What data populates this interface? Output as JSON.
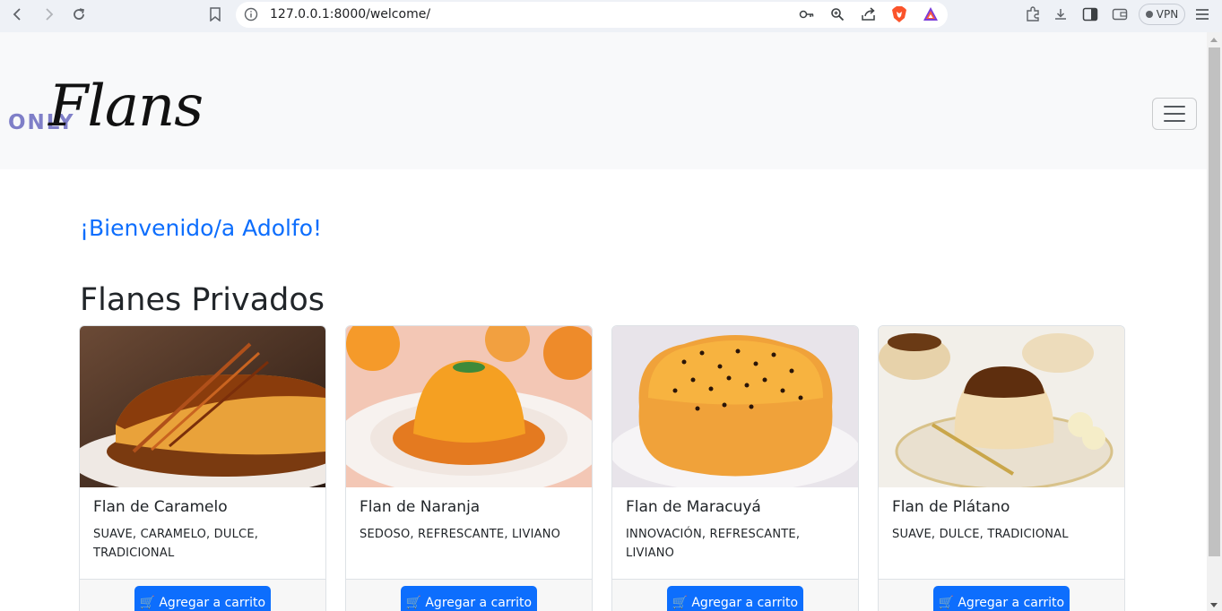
{
  "browser": {
    "url": "127.0.0.1:8000/welcome/",
    "vpn_label": "VPN"
  },
  "navbar": {
    "brand_only": "ONLY",
    "brand_flans": "Flans"
  },
  "welcome_text": "¡Bienvenido/a Adolfo!",
  "section_title": "Flanes Privados",
  "cards": [
    {
      "title": "Flan de Caramelo",
      "tags": "SUAVE, CARAMELO, DULCE, TRADICIONAL",
      "button": "Agregar a carrito"
    },
    {
      "title": "Flan de Naranja",
      "tags": "SEDOSO, REFRESCANTE, LIVIANO",
      "button": "Agregar a carrito"
    },
    {
      "title": "Flan de Maracuyá",
      "tags": "INNOVACIÓN, REFRESCANTE, LIVIANO",
      "button": "Agregar a carrito"
    },
    {
      "title": "Flan de Plátano",
      "tags": "SUAVE, DULCE, TRADICIONAL",
      "button": "Agregar a carrito"
    }
  ],
  "colors": {
    "accent": "#0d6efd",
    "navbar_bg": "#f8f9fa",
    "brand_only": "#7f7fc8"
  }
}
